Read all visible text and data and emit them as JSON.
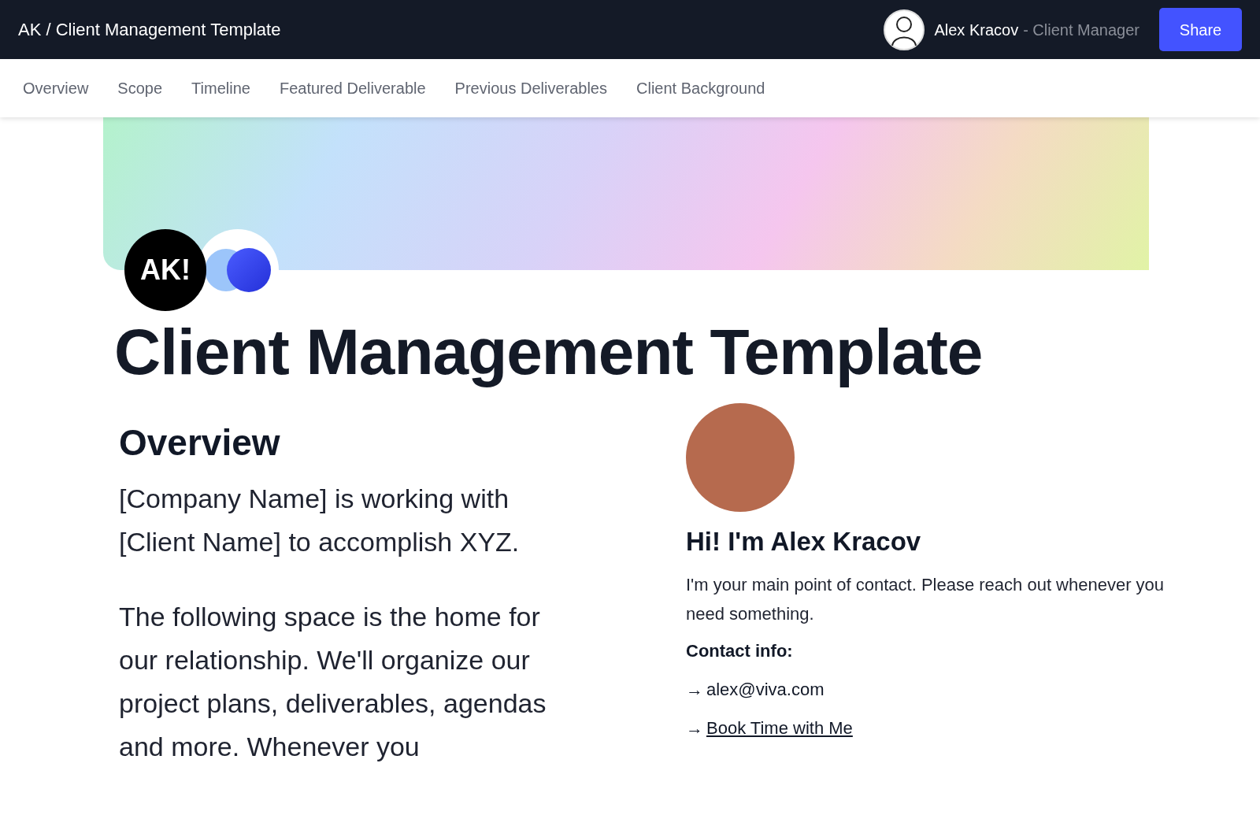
{
  "header": {
    "breadcrumb": "AK / Client Management Template",
    "user_name": "Alex Kracov",
    "user_role": "- Client Manager",
    "share_button": "Share"
  },
  "nav": [
    {
      "label": "Overview"
    },
    {
      "label": "Scope"
    },
    {
      "label": "Timeline"
    },
    {
      "label": "Featured Deliverable"
    },
    {
      "label": "Previous Deliverables"
    },
    {
      "label": "Client Background"
    }
  ],
  "logo_text": "AK!",
  "title": "Client Management Template",
  "overview": {
    "heading": "Overview",
    "paragraphs": [
      "[Company Name] is working with [Client Name] to accomplish XYZ.",
      "The following space is the home for our relationship. We'll organize our project plans, deliverables, agendas and more. Whenever you"
    ]
  },
  "contact": {
    "heading": "Hi! I'm Alex Kracov",
    "intro": "I'm your main point of contact. Please reach out whenever you need something.",
    "info_label": "Contact info:",
    "items": [
      {
        "kind": "text",
        "arrow": "→",
        "text": "alex@viva.com"
      },
      {
        "kind": "link",
        "arrow": "→",
        "text": "Book Time with Me"
      }
    ]
  }
}
